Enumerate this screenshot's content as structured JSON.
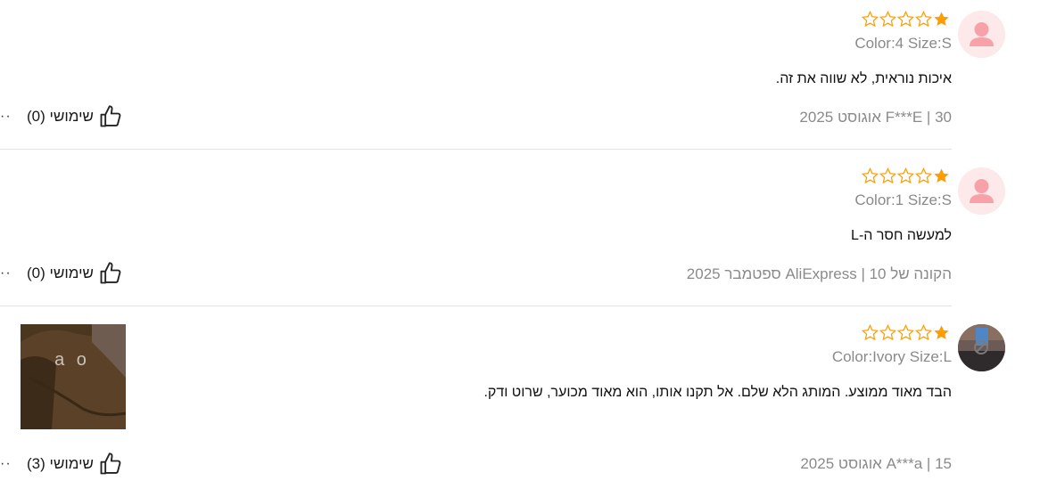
{
  "reviews": [
    {
      "stars_filled": 1,
      "sku": "Color:4 Size:S",
      "text": "איכות נוראית, לא שווה את זה.",
      "date_line": "30 | F***E אוגוסט 2025",
      "helpful_label": "שימושי (0)",
      "more_label": "··"
    },
    {
      "stars_filled": 1,
      "sku": "Color:1 Size:S",
      "text": "למעשה חסר ה-L",
      "date_line": "הקונה של AliExpress | 10 ספטמבר 2025",
      "helpful_label": "שימושי (0)",
      "more_label": "··"
    },
    {
      "stars_filled": 1,
      "sku": "Color:Ivory Size:L",
      "text": "הבד מאוד ממוצע. המותג הלא שלם. אל תקנו אותו, הוא מאוד מכוער, שרוט ודק.",
      "date_line": "15 | A***a אוגוסט 2025",
      "helpful_label": "שימושי (3)",
      "more_label": "··",
      "photo_text": "a o"
    }
  ],
  "colors": {
    "star": "#ff9c00",
    "avatar_default_bg": "#fde8ea",
    "avatar_default_icon": "#f7a1a8"
  },
  "icons": {
    "star": "star-icon",
    "helpful": "thumbs-up-icon",
    "avatar": "user-avatar-icon"
  }
}
